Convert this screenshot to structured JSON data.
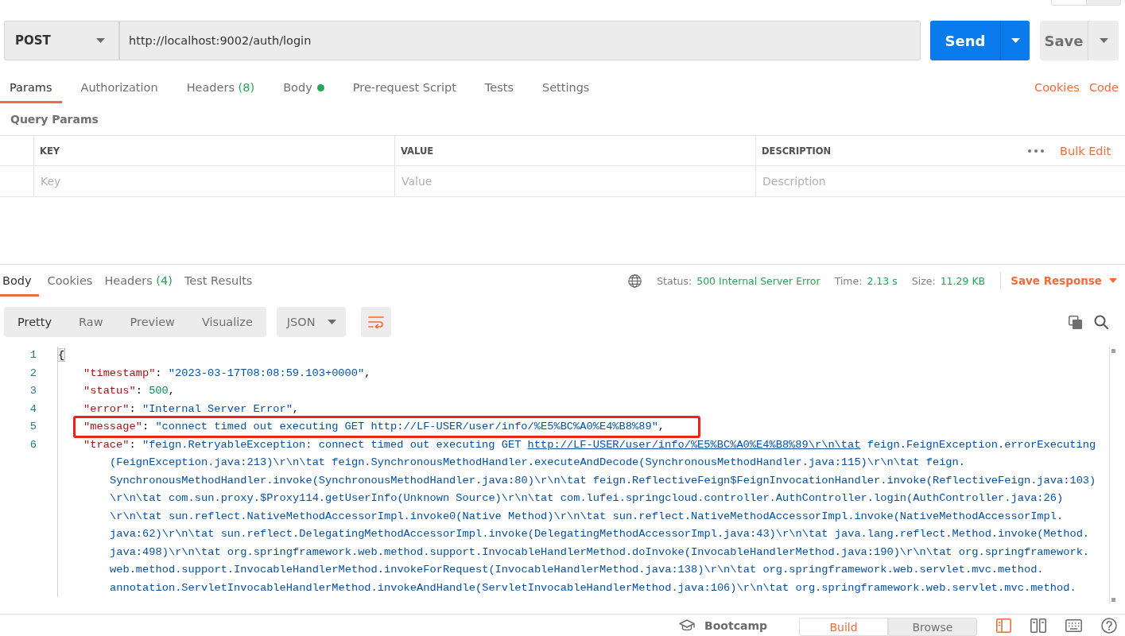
{
  "top_switch": [
    {
      "selected": true
    },
    {
      "selected": false
    }
  ],
  "request": {
    "method": "POST",
    "url": "http://localhost:9002/auth/login",
    "send": "Send",
    "save": "Save"
  },
  "request_tabs": [
    {
      "label": "Params",
      "selected": true,
      "indicator": false
    },
    {
      "label": "Authorization",
      "selected": false,
      "indicator": false
    },
    {
      "label": "Headers",
      "count": "(8)",
      "selected": false,
      "indicator": false
    },
    {
      "label": "Body",
      "selected": false,
      "indicator": true
    },
    {
      "label": "Pre-request Script",
      "selected": false,
      "indicator": false
    },
    {
      "label": "Tests",
      "selected": false,
      "indicator": false
    },
    {
      "label": "Settings",
      "selected": false,
      "indicator": false
    }
  ],
  "request_links": [
    "Cookies",
    "Code"
  ],
  "query_params": {
    "title": "Query Params",
    "columns": [
      "KEY",
      "VALUE",
      "DESCRIPTION"
    ],
    "bulk_edit": "Bulk Edit",
    "placeholders": [
      "Key",
      "Value",
      "Description"
    ]
  },
  "response": {
    "tabs": [
      {
        "label": "Body",
        "selected": true
      },
      {
        "label": "Cookies",
        "selected": false
      },
      {
        "label": "Headers",
        "count": "(4)",
        "selected": false
      },
      {
        "label": "Test Results",
        "selected": false
      }
    ],
    "stats": [
      {
        "label": "Status:",
        "value": "500 Internal Server Error"
      },
      {
        "label": "Time:",
        "value": "2.13 s"
      },
      {
        "label": "Size:",
        "value": "11.29 KB"
      }
    ],
    "save_response": "Save Response",
    "views": [
      {
        "label": "Pretty",
        "selected": true
      },
      {
        "label": "Raw",
        "selected": false
      },
      {
        "label": "Preview",
        "selected": false
      },
      {
        "label": "Visualize",
        "selected": false
      }
    ],
    "format": "JSON",
    "line_wrap": true
  },
  "code": {
    "lines": [
      {
        "kind": "open",
        "number": "1",
        "highlighted": false,
        "tokens": [
          {
            "kind": "brace",
            "text": "{"
          }
        ]
      },
      {
        "kind": "member",
        "number": "2",
        "highlighted": false,
        "tokens": [
          {
            "kind": "key",
            "text": "\"timestamp\""
          },
          {
            "kind": "punct",
            "text": ": "
          },
          {
            "kind": "string",
            "text": "\"2023-03-17T08:08:59.103+0000\""
          },
          {
            "kind": "punct",
            "text": ","
          }
        ]
      },
      {
        "kind": "member",
        "number": "3",
        "highlighted": false,
        "tokens": [
          {
            "kind": "key",
            "text": "\"status\""
          },
          {
            "kind": "punct",
            "text": ": "
          },
          {
            "kind": "number",
            "text": "500"
          },
          {
            "kind": "punct",
            "text": ","
          }
        ]
      },
      {
        "kind": "member",
        "number": "4",
        "highlighted": false,
        "tokens": [
          {
            "kind": "key",
            "text": "\"error\""
          },
          {
            "kind": "punct",
            "text": ": "
          },
          {
            "kind": "string",
            "text": "\"Internal Server Error\""
          },
          {
            "kind": "punct",
            "text": ","
          }
        ]
      },
      {
        "kind": "member",
        "number": "5",
        "highlighted": true,
        "tokens": [
          {
            "kind": "key",
            "text": "\"message\""
          },
          {
            "kind": "punct",
            "text": ": "
          },
          {
            "kind": "string",
            "text": "\"connect timed out executing GET http://LF-USER/user/info/%E5%BC%A0%E4%B8%89\""
          },
          {
            "kind": "punct",
            "text": ","
          }
        ]
      },
      {
        "kind": "member",
        "number": "6",
        "highlighted": false,
        "tokens": [
          {
            "kind": "key",
            "text": "\"trace\""
          },
          {
            "kind": "punct",
            "text": ": "
          },
          {
            "kind": "string",
            "text": "\"feign.RetryableException: connect timed out executing GET "
          },
          {
            "kind": "link",
            "text": "http://LF-USER/user/info/%E5%BC%A0%E4%B8%89\\r\\n\\tat"
          },
          {
            "kind": "string",
            "text": " feign.FeignException.errorExecuting"
          }
        ]
      },
      {
        "kind": "wrap",
        "highlighted": false,
        "tokens": [
          {
            "kind": "string",
            "text": "(FeignException.java:213)\\r\\n\\tat feign.SynchronousMethodHandler.executeAndDecode(SynchronousMethodHandler.java:115)\\r\\n\\tat feign."
          }
        ]
      },
      {
        "kind": "wrap",
        "highlighted": false,
        "tokens": [
          {
            "kind": "string",
            "text": "SynchronousMethodHandler.invoke(SynchronousMethodHandler.java:80)\\r\\n\\tat feign.ReflectiveFeign$FeignInvocationHandler.invoke(ReflectiveFeign.java:103)"
          }
        ]
      },
      {
        "kind": "wrap",
        "highlighted": false,
        "tokens": [
          {
            "kind": "string",
            "text": "\\r\\n\\tat com.sun.proxy.$Proxy114.getUserInfo(Unknown Source)\\r\\n\\tat com.lufei.springcloud.controller.AuthController.login(AuthController.java:26)"
          }
        ]
      },
      {
        "kind": "wrap",
        "highlighted": false,
        "tokens": [
          {
            "kind": "string",
            "text": "\\r\\n\\tat sun.reflect.NativeMethodAccessorImpl.invoke0(Native Method)\\r\\n\\tat sun.reflect.NativeMethodAccessorImpl.invoke(NativeMethodAccessorImpl."
          }
        ]
      },
      {
        "kind": "wrap",
        "highlighted": false,
        "tokens": [
          {
            "kind": "string",
            "text": "java:62)\\r\\n\\tat sun.reflect.DelegatingMethodAccessorImpl.invoke(DelegatingMethodAccessorImpl.java:43)\\r\\n\\tat java.lang.reflect.Method.invoke(Method."
          }
        ]
      },
      {
        "kind": "wrap",
        "highlighted": false,
        "tokens": [
          {
            "kind": "string",
            "text": "java:498)\\r\\n\\tat org.springframework.web.method.support.InvocableHandlerMethod.doInvoke(InvocableHandlerMethod.java:190)\\r\\n\\tat org.springframework."
          }
        ]
      },
      {
        "kind": "wrap",
        "highlighted": false,
        "tokens": [
          {
            "kind": "string",
            "text": "web.method.support.InvocableHandlerMethod.invokeForRequest(InvocableHandlerMethod.java:138)\\r\\n\\tat org.springframework.web.servlet.mvc.method."
          }
        ]
      },
      {
        "kind": "wrap",
        "highlighted": false,
        "tokens": [
          {
            "kind": "string",
            "text": "annotation.ServletInvocableHandlerMethod.invokeAndHandle(ServletInvocableHandlerMethod.java:106)\\r\\n\\tat org.springframework.web.servlet.mvc.method."
          }
        ]
      }
    ]
  },
  "footer": {
    "bootcamp": "Bootcamp",
    "modes": [
      {
        "label": "Build",
        "selected": true
      },
      {
        "label": "Browse",
        "selected": false
      }
    ]
  }
}
